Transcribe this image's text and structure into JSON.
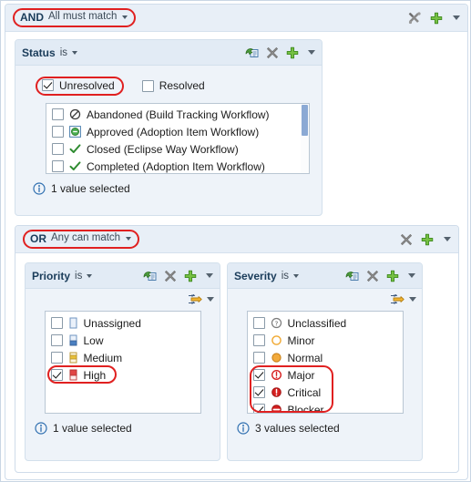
{
  "and_group": {
    "operator": "AND",
    "description": "All must match",
    "tools": {
      "bin_label": "bin-icon",
      "add_label": "add-icon"
    }
  },
  "or_group": {
    "operator": "OR",
    "description": "Any can match"
  },
  "status_clause": {
    "field": "Status",
    "operator": "is",
    "quick_options": [
      {
        "label": "Unresolved",
        "checked": true,
        "highlighted": true
      },
      {
        "label": "Resolved",
        "checked": false,
        "highlighted": false
      }
    ],
    "options": [
      {
        "label": "Abandoned (Build Tracking Workflow)",
        "checked": false,
        "icon": "no-entry-icon"
      },
      {
        "label": "Approved (Adoption Item Workflow)",
        "checked": false,
        "icon": "approved-icon"
      },
      {
        "label": "Closed (Eclipse Way Workflow)",
        "checked": false,
        "icon": "check-icon"
      },
      {
        "label": "Completed (Adoption Item Workflow)",
        "checked": false,
        "icon": "check-icon"
      }
    ],
    "selection_note": "1 value selected"
  },
  "priority_clause": {
    "field": "Priority",
    "operator": "is",
    "options": [
      {
        "label": "Unassigned",
        "checked": false,
        "icon": "priority-unassigned-icon"
      },
      {
        "label": "Low",
        "checked": false,
        "icon": "priority-low-icon"
      },
      {
        "label": "Medium",
        "checked": false,
        "icon": "priority-medium-icon"
      },
      {
        "label": "High",
        "checked": true,
        "icon": "priority-high-icon"
      }
    ],
    "selection_note": "1 value selected"
  },
  "severity_clause": {
    "field": "Severity",
    "operator": "is",
    "options": [
      {
        "label": "Unclassified",
        "checked": false,
        "icon": "severity-unclassified-icon"
      },
      {
        "label": "Minor",
        "checked": false,
        "icon": "severity-minor-icon"
      },
      {
        "label": "Normal",
        "checked": false,
        "icon": "severity-normal-icon"
      },
      {
        "label": "Major",
        "checked": true,
        "icon": "severity-major-icon"
      },
      {
        "label": "Critical",
        "checked": true,
        "icon": "severity-critical-icon"
      },
      {
        "label": "Blocker",
        "checked": true,
        "icon": "severity-blocker-icon"
      }
    ],
    "selection_note": "3 values selected"
  },
  "colors": {
    "highlight": "#e02020",
    "panel_header": "#e2ebf5",
    "group_header": "#e8eff7",
    "accent_blue": "#1a3c5a",
    "severity_red": "#d62020",
    "severity_orange": "#f0a830",
    "priority_red": "#e04545",
    "priority_yellow": "#e8c03a",
    "priority_blue": "#4a7fc1",
    "scrollbar_thumb": "#8ba9d4"
  }
}
